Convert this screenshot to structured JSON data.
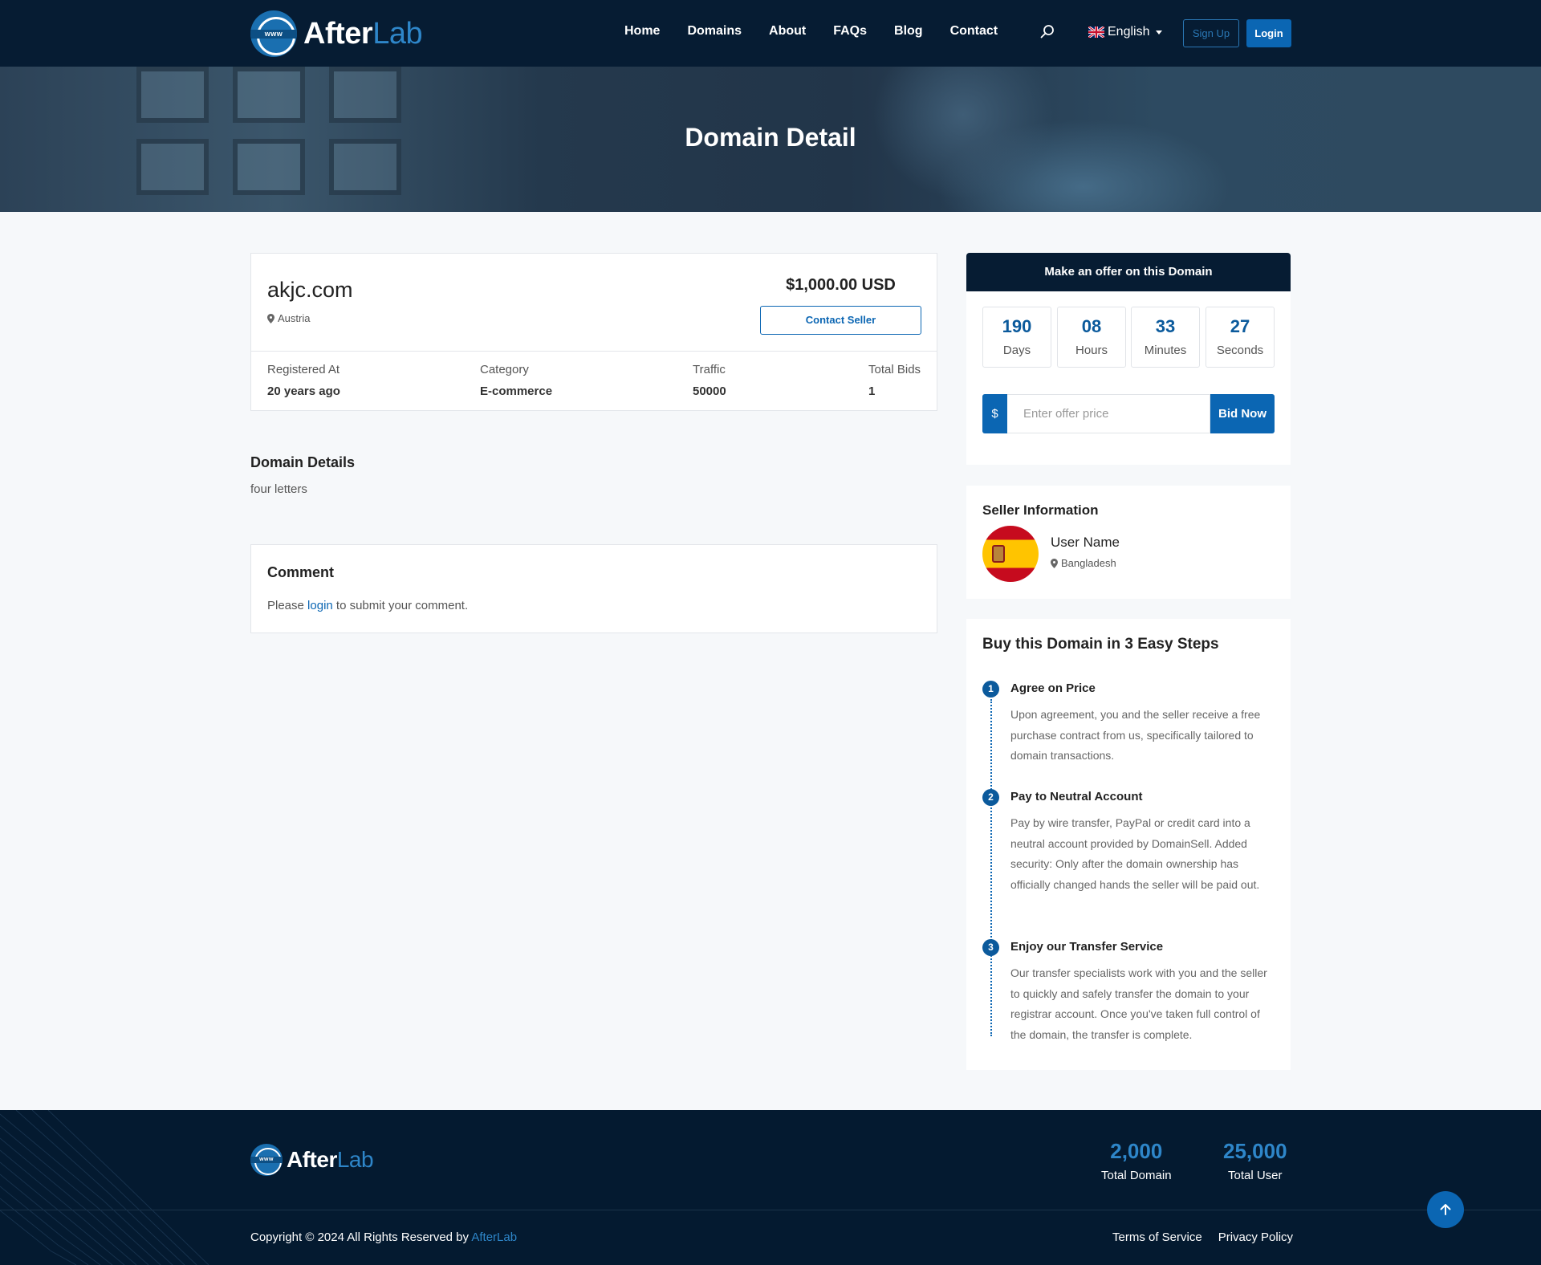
{
  "brand": {
    "name_part1": "After",
    "name_part2": "Lab",
    "mark_text": "www"
  },
  "nav": {
    "items": [
      "Home",
      "Domains",
      "About",
      "FAQs",
      "Blog",
      "Contact"
    ],
    "language": "English",
    "signup_label": "Sign Up",
    "login_label": "Login"
  },
  "hero": {
    "title": "Domain Detail"
  },
  "domain": {
    "name": "akjc.com",
    "location": "Austria",
    "price": "$1,000.00 USD",
    "contact_label": "Contact Seller",
    "stats": [
      {
        "label": "Registered At",
        "value": "20 years ago"
      },
      {
        "label": "Category",
        "value": "E-commerce"
      },
      {
        "label": "Traffic",
        "value": "50000"
      },
      {
        "label": "Total Bids",
        "value": "1"
      }
    ]
  },
  "details": {
    "title": "Domain Details",
    "text": "four letters"
  },
  "comment": {
    "title": "Comment",
    "prefix": "Please ",
    "link": "login",
    "suffix": " to submit your comment."
  },
  "offer": {
    "title": "Make an offer on this Domain",
    "countdown": [
      {
        "value": "190",
        "unit": "Days"
      },
      {
        "value": "08",
        "unit": "Hours"
      },
      {
        "value": "33",
        "unit": "Minutes"
      },
      {
        "value": "27",
        "unit": "Seconds"
      }
    ],
    "currency_symbol": "$",
    "input_placeholder": "Enter offer price",
    "bid_label": "Bid Now"
  },
  "seller": {
    "title": "Seller Information",
    "name": "User Name",
    "location": "Bangladesh"
  },
  "steps": {
    "title": "Buy this Domain in 3 Easy Steps",
    "items": [
      {
        "num": "1",
        "title": "Agree on Price",
        "text": "Upon agreement, you and the seller receive a free purchase contract from us, specifically tailored to domain transactions."
      },
      {
        "num": "2",
        "title": "Pay to Neutral Account",
        "text": "Pay by wire transfer, PayPal or credit card into a neutral account provided by DomainSell. Added security: Only after the domain ownership has officially changed hands the seller will be paid out."
      },
      {
        "num": "3",
        "title": "Enjoy our Transfer Service",
        "text": "Our transfer specialists work with you and the seller to quickly and safely transfer the domain to your registrar account. Once you've taken full control of the domain, the transfer is complete."
      }
    ]
  },
  "footer": {
    "stats": [
      {
        "value": "2,000",
        "label": "Total Domain"
      },
      {
        "value": "25,000",
        "label": "Total User"
      }
    ],
    "copyright_prefix": "Copyright © 2024 All Rights Reserved by ",
    "copyright_brand": "AfterLab",
    "links": [
      "Terms of Service",
      "Privacy Policy"
    ]
  },
  "colors": {
    "nav_bg": "#061c33",
    "primary": "#0b66b3",
    "accent": "#2e86c9",
    "page_bg": "#f6f8fa"
  }
}
